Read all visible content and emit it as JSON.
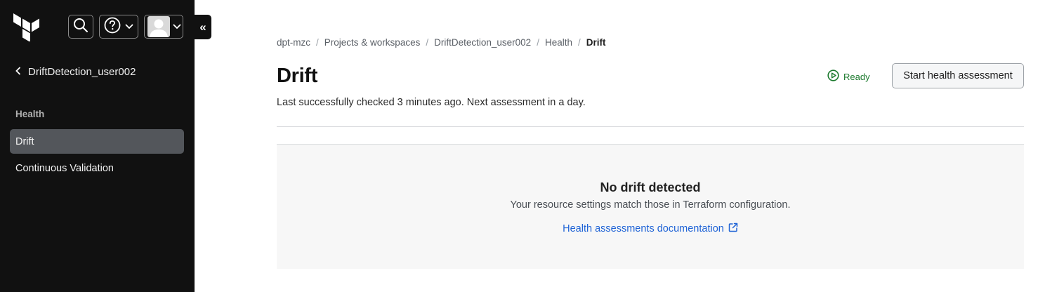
{
  "sidebar": {
    "logo": "terraform-logo",
    "back_label": "DriftDetection_user002",
    "section_label": "Health",
    "items": [
      {
        "label": "Drift",
        "active": true
      },
      {
        "label": "Continuous Validation",
        "active": false
      }
    ],
    "collapse_glyph": "«"
  },
  "breadcrumb": [
    "dpt-mzc",
    "Projects & workspaces",
    "DriftDetection_user002",
    "Health",
    "Drift"
  ],
  "page": {
    "title": "Drift",
    "subtitle": "Last successfully checked 3 minutes ago. Next assessment in a day.",
    "status": "Ready",
    "start_button": "Start health assessment"
  },
  "empty_state": {
    "title": "No drift detected",
    "description": "Your resource settings match those in Terraform configuration.",
    "link": "Health assessments documentation"
  },
  "colors": {
    "sidebar_bg": "#111111",
    "active_item_bg": "#53565b",
    "status_green": "#1c7a2e",
    "link_blue": "#1f63d6"
  }
}
